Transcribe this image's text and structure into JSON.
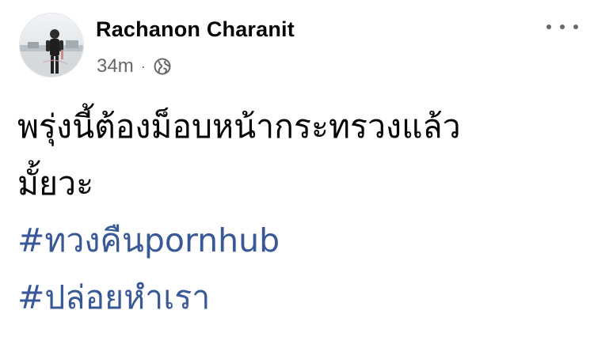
{
  "post": {
    "author": "Rachanon Charanit",
    "time": "34m",
    "separator": "·",
    "privacy_icon": "globe-icon",
    "more_icon": "more-horizontal-icon",
    "avatar_icon": "profile-photo",
    "text_lines": [
      "พรุ่งนี้ต้องม็อบหน้ากระทรวงแล้ว",
      "มั้ยวะ"
    ],
    "hashtags": [
      "#ทวงคืนpornhub",
      "#ปล่อยหำเรา"
    ]
  },
  "colors": {
    "hashtag": "#385898",
    "meta": "#65676b",
    "text": "#050505",
    "background": "#ffffff"
  }
}
